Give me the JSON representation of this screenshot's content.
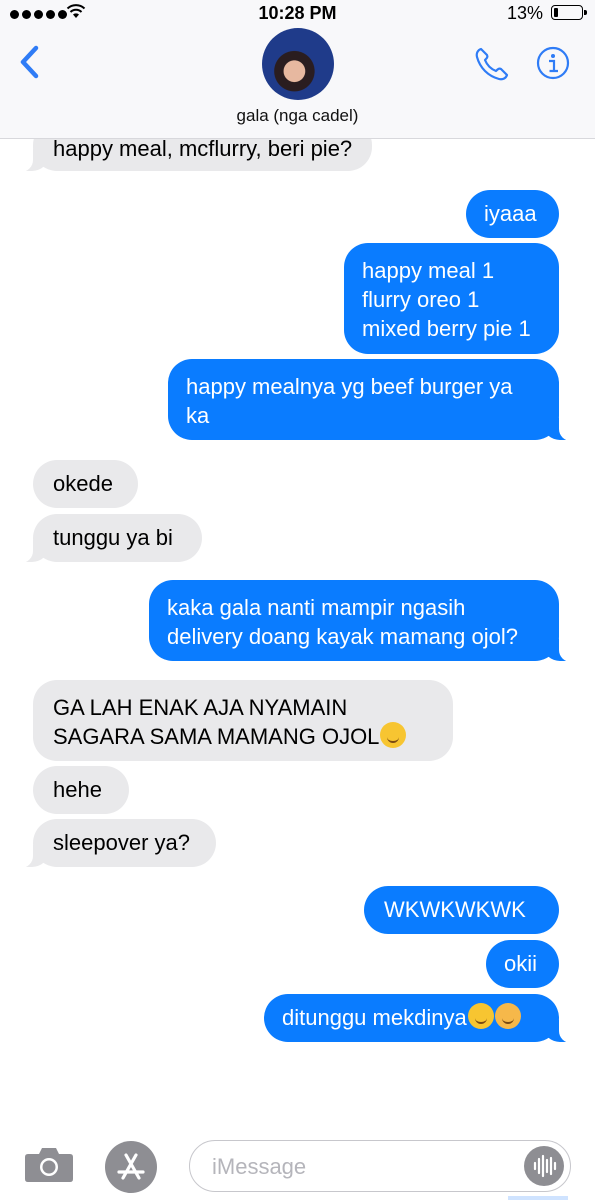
{
  "status_bar": {
    "time": "10:28 PM",
    "battery_percent": "13%",
    "battery_level": 0.13,
    "signal_bars": 5
  },
  "header": {
    "contact_name": "gala (nga cadel)",
    "accent_color": "#2f7cf6",
    "icons": {
      "back": "chevron-left-icon",
      "phone": "phone-icon",
      "info": "info-icon"
    }
  },
  "messages": [
    {
      "from": "contact",
      "lines": [
        "happy meal, mcflurry, beri pie?"
      ],
      "tail": true
    },
    {
      "from": "me",
      "lines": [
        "iyaaa"
      ],
      "tail": false
    },
    {
      "from": "me",
      "lines": [
        "happy meal 1",
        "flurry oreo 1",
        "mixed berry pie 1"
      ],
      "tail": false
    },
    {
      "from": "me",
      "lines": [
        "happy mealnya yg beef burger ya",
        "ka"
      ],
      "tail": true
    },
    {
      "from": "contact",
      "lines": [
        "okede"
      ],
      "tail": false
    },
    {
      "from": "contact",
      "lines": [
        "tunggu ya bi"
      ],
      "tail": true
    },
    {
      "from": "me",
      "lines": [
        "kaka gala nanti mampir ngasih",
        "delivery doang kayak mamang ojol?"
      ],
      "tail": true
    },
    {
      "from": "contact",
      "lines": [
        "GA LAH ENAK AJA NYAMAIN",
        "SAGARA SAMA MAMANG OJOL"
      ],
      "emoji": [
        "face-with-steam-icon"
      ],
      "tail": false
    },
    {
      "from": "contact",
      "lines": [
        "hehe"
      ],
      "tail": false
    },
    {
      "from": "contact",
      "lines": [
        "sleepover ya?"
      ],
      "tail": true
    },
    {
      "from": "me",
      "lines": [
        "WKWKWKWK"
      ],
      "tail": false
    },
    {
      "from": "me",
      "lines": [
        "okii"
      ],
      "tail": false
    },
    {
      "from": "me",
      "lines": [
        "ditunggu mekdinya"
      ],
      "emoji": [
        "hugging-face-icon",
        "smiling-face-with-hearts-icon"
      ],
      "tail": true
    }
  ],
  "colors": {
    "sent_bubble": "#0a7cff",
    "received_bubble": "#e9e9eb"
  },
  "input_bar": {
    "placeholder": "iMessage",
    "icons": {
      "camera": "camera-icon",
      "apps": "app-store-icon",
      "audio": "audio-waveform-icon"
    }
  }
}
